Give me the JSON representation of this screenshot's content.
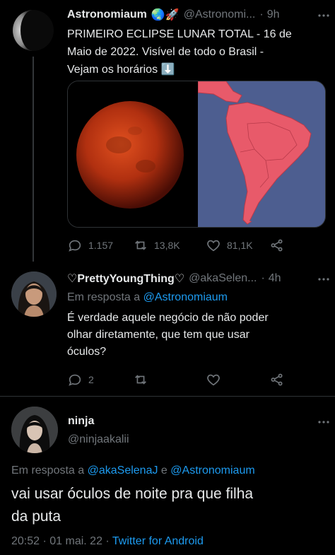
{
  "tweet1": {
    "display_name": "Astronomiaum",
    "emojis": "🌏🚀",
    "handle": "@Astronomi...",
    "dot": "·",
    "time": "9h",
    "text_line1": "PRIMEIRO ECLIPSE LUNAR TOTAL - 16 de",
    "text_line2": "Maio de 2022. Visível de todo o Brasil -",
    "text_line3": "Vejam os horários",
    "text_emoji": "⬇️",
    "reply_count": "1.157",
    "retweet_count": "13,8K",
    "like_count": "81,1K",
    "icons": [
      "reply-icon",
      "retweet-icon",
      "like-icon",
      "share-icon"
    ]
  },
  "tweet2": {
    "display_name": "♡PrettyYoungThing♡",
    "handle": "@akaSelen...",
    "dot": "·",
    "time": "4h",
    "reply_prefix": "Em resposta a",
    "reply_mention": "@Astronomiaum",
    "text_line1": "É verdade aquele negócio de não poder",
    "text_line2": "olhar diretamente, que tem que usar",
    "text_line3": "óculos?",
    "reply_count": "2",
    "icons": [
      "reply-icon",
      "retweet-icon",
      "like-icon",
      "share-icon"
    ]
  },
  "tweet3": {
    "display_name": "ninja",
    "handle": "@ninjaakalii",
    "reply_prefix": "Em resposta a",
    "reply_mention1": "@akaSelenaJ",
    "reply_and": "e",
    "reply_mention2": "@Astronomiaum",
    "text_line1": "vai usar óculos de noite pra que filha",
    "text_line2": "da puta",
    "timestamp": "20:52 · 01 mai. 22 ·",
    "source": "Twitter for Android"
  },
  "colors": {
    "background": "#000000",
    "text": "#e7e9ea",
    "muted": "#71767b",
    "link": "#1d9bf0",
    "map_land": "#e85a6a",
    "map_sea": "#4a5a8a"
  }
}
